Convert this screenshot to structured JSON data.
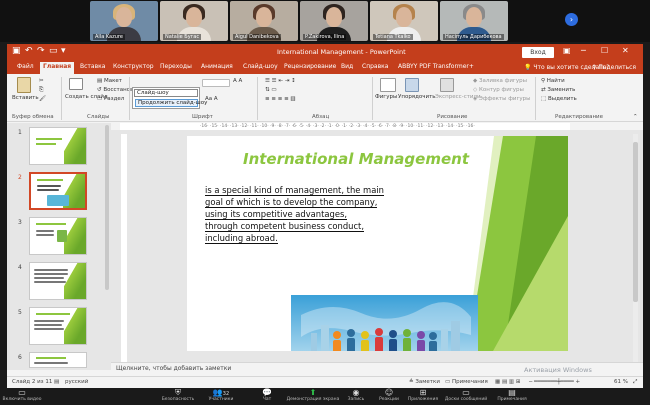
{
  "participants": [
    {
      "name": "Alla Kazure",
      "bg": "#6f8ba6",
      "hair": "#d8b47a",
      "body": "#3c3c44"
    },
    {
      "name": "Natalie Бугас",
      "bg": "#c9c1b6",
      "hair": "#3a2a20",
      "body": "#e8e2da"
    },
    {
      "name": "Aigul Danibekova",
      "bg": "#b7ada0",
      "hair": "#5a3a2a",
      "body": "#6a5a4a"
    },
    {
      "name": "P.Zakirova, Ilina",
      "bg": "#a7a39e",
      "hair": "#2e241f",
      "body": "#1e1e1e"
    },
    {
      "name": "Tetiana Tkalko",
      "bg": "#cfc7bb",
      "hair": "#b5834d",
      "body": "#eeeeee"
    },
    {
      "name": "Насіпуль Дарибекова",
      "bg": "#b5b9b8",
      "hair": "#8a8a8a",
      "body": "#2e5a8e"
    }
  ],
  "window": {
    "title": "International Management  -  PowerPoint",
    "login": "Вход"
  },
  "tabs": [
    "Файл",
    "Главная",
    "Вставка",
    "Конструктор",
    "Переходы",
    "Анимация",
    "Слайд-шоу",
    "Рецензирование",
    "Вид",
    "Справка",
    "ABBYY PDF Transformer+"
  ],
  "tell_me": "Что вы хотите сделать?",
  "share": "Поделиться",
  "ribbon": {
    "paste": "Вставить",
    "clipboard": "Буфер обмена",
    "create_slide": "Создать слайд",
    "layout": "Макет",
    "reset": "Восстановить",
    "section": "Раздел",
    "slides": "Слайды",
    "font": "Шрифт",
    "paragraph": "Абзац",
    "figures": "Фигуры",
    "arrange": "Упорядочить",
    "express_styles": "Экспресс-стили",
    "fill": "Заливка фигуры",
    "outline": "Контур фигуры",
    "effects": "Эффекты фигуры",
    "drawing": "Рисование",
    "find": "Найти",
    "replace": "Заменить",
    "select": "Выделить",
    "editing": "Редактирование",
    "font_popup_value": "Слайд-шоу",
    "font_popup_option": "Продолжить слайд-шоу"
  },
  "ruler_ticks": "·16· ·15· ·14· ·13· ·12· ·11· ·10· ·9· ·8· ·7· ·6· ·5· ·4· ·3· ·2· ·1· ·0· ·1· ·2· ·3· ·4· ·5· ·6· ·7· ·8· ·9· ·10· ·11· ·12· ·13· ·14· ·15· ·16·",
  "thumbnails": [
    "1",
    "2",
    "3",
    "4",
    "5",
    "6"
  ],
  "slide": {
    "title": "International Management",
    "body": [
      "is a special kind of management, the main",
      "goal of which is to develop the company,",
      "using its competitive advantages,",
      "through competent business conduct,",
      "including abroad."
    ]
  },
  "notes_placeholder": "Щелкните, чтобы добавить заметки",
  "status": {
    "slide": "Слайд 2 из 11",
    "lang": "русский",
    "notes": "Заметки",
    "comments": "Примечания",
    "zoom": "61 %"
  },
  "watermark": "Активация Windows",
  "zoom_controls": {
    "video": "Включить видео",
    "security": "Безопасность",
    "participants": "Участники",
    "participants_count": "32",
    "chat": "Чат",
    "share": "Демонстрация экрана",
    "record": "Запись",
    "reactions": "Реакции",
    "apps": "Приложения",
    "whiteboards": "Доски сообщений",
    "notes": "Примечания"
  }
}
